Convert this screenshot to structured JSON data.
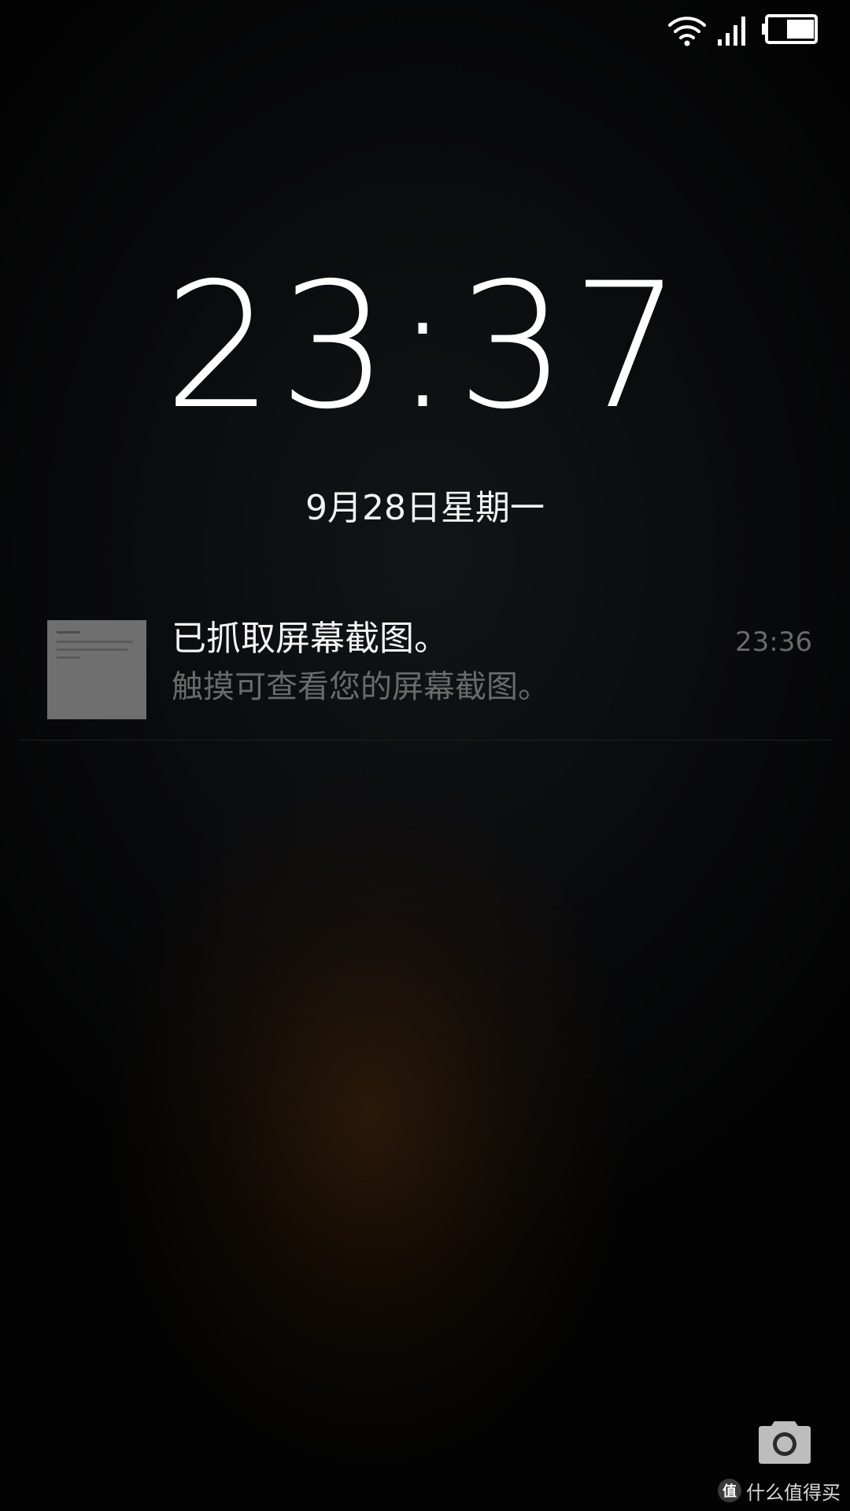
{
  "status_bar": {
    "wifi_icon": "wifi-icon",
    "signal_icon": "cellular-signal-icon",
    "battery_icon": "battery-icon",
    "battery_level": 0.6
  },
  "lockscreen": {
    "time": "23:37",
    "date": "9月28日星期一"
  },
  "notification": {
    "title": "已抓取屏幕截图。",
    "text": "触摸可查看您的屏幕截图。",
    "time": "23:36",
    "thumbnail_icon": "screenshot-thumbnail"
  },
  "shortcuts": {
    "camera_icon": "camera-icon"
  },
  "watermark": {
    "logo_char": "值",
    "text": "什么值得买"
  },
  "colors": {
    "text_primary": "#f4f4f4",
    "text_secondary": "#6a6a6a",
    "background": "#0a0b0d"
  }
}
